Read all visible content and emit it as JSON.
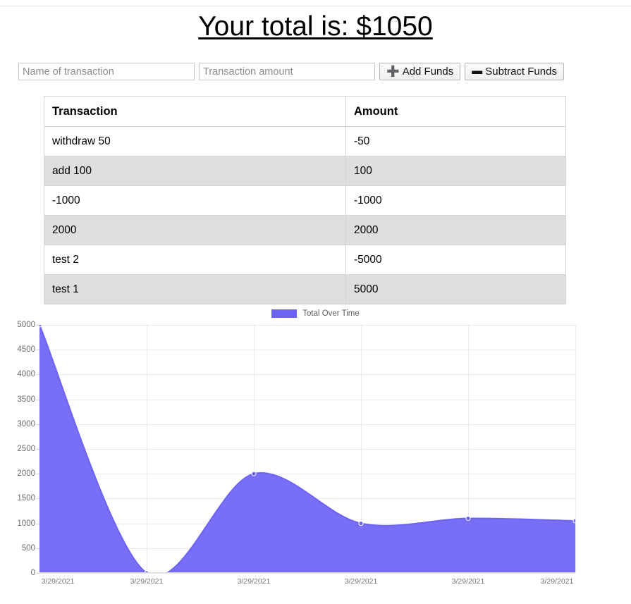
{
  "header": {
    "title_prefix": "Your total is: ",
    "total": "$1050",
    "title_full": "Your total is: $1050"
  },
  "form": {
    "name_placeholder": "Name of transaction",
    "name_value": "",
    "amount_placeholder": "Transaction amount",
    "amount_value": "",
    "add_button_label": "Add Funds",
    "add_button_icon": "plus-icon",
    "subtract_button_label": "Subtract Funds",
    "subtract_button_icon": "minus-icon"
  },
  "table": {
    "columns": [
      "Transaction",
      "Amount"
    ],
    "rows": [
      {
        "transaction": "withdraw 50",
        "amount": "-50"
      },
      {
        "transaction": "add 100",
        "amount": "100"
      },
      {
        "transaction": "-1000",
        "amount": "-1000"
      },
      {
        "transaction": "2000",
        "amount": "2000"
      },
      {
        "transaction": "test 2",
        "amount": "-5000"
      },
      {
        "transaction": "test 1",
        "amount": "5000"
      }
    ]
  },
  "chart_data": {
    "type": "area",
    "title": "",
    "xlabel": "",
    "ylabel": "",
    "legend": [
      "Total Over Time"
    ],
    "legend_position": "top-center",
    "color": "#6C63F5",
    "grid": true,
    "ylim": [
      0,
      5000
    ],
    "yticks": [
      "0",
      "500",
      "1000",
      "1500",
      "2000",
      "2500",
      "3000",
      "3500",
      "4000",
      "4500",
      "5000"
    ],
    "x": [
      "3/29/2021",
      "3/29/2021",
      "3/29/2021",
      "3/29/2021",
      "3/29/2021",
      "3/29/2021"
    ],
    "series": [
      {
        "name": "Total Over Time",
        "values": [
          5000,
          0,
          2000,
          1000,
          1100,
          1050
        ]
      }
    ]
  }
}
